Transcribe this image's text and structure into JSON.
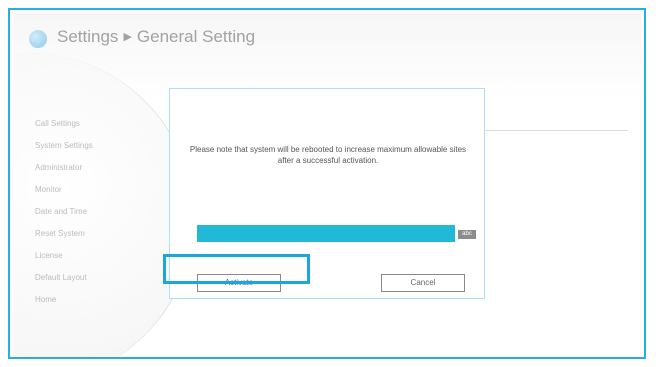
{
  "header": {
    "breadcrumb_root": "Settings",
    "breadcrumb_sep": "▶",
    "breadcrumb_current": "General Setting"
  },
  "sidebar": {
    "items": [
      {
        "label": "Call Settings"
      },
      {
        "label": "System Settings"
      },
      {
        "label": "Administrator"
      },
      {
        "label": "Monitor"
      },
      {
        "label": "Date and Time"
      },
      {
        "label": "Reset System"
      },
      {
        "label": "License"
      },
      {
        "label": "Default Layout"
      },
      {
        "label": "Home"
      }
    ]
  },
  "dialog": {
    "message": "Please note that system will be rebooted to increase maximum allowable sites after a successful activation.",
    "key_input": {
      "value": ""
    },
    "ime_badge": "abc",
    "activate_label": "Activate",
    "cancel_label": "Cancel"
  },
  "colors": {
    "accent": "#27aee4",
    "input_fill": "#22b9d9",
    "highlight": "#1aa7e0"
  },
  "icons": {
    "logo": "logo-icon"
  }
}
